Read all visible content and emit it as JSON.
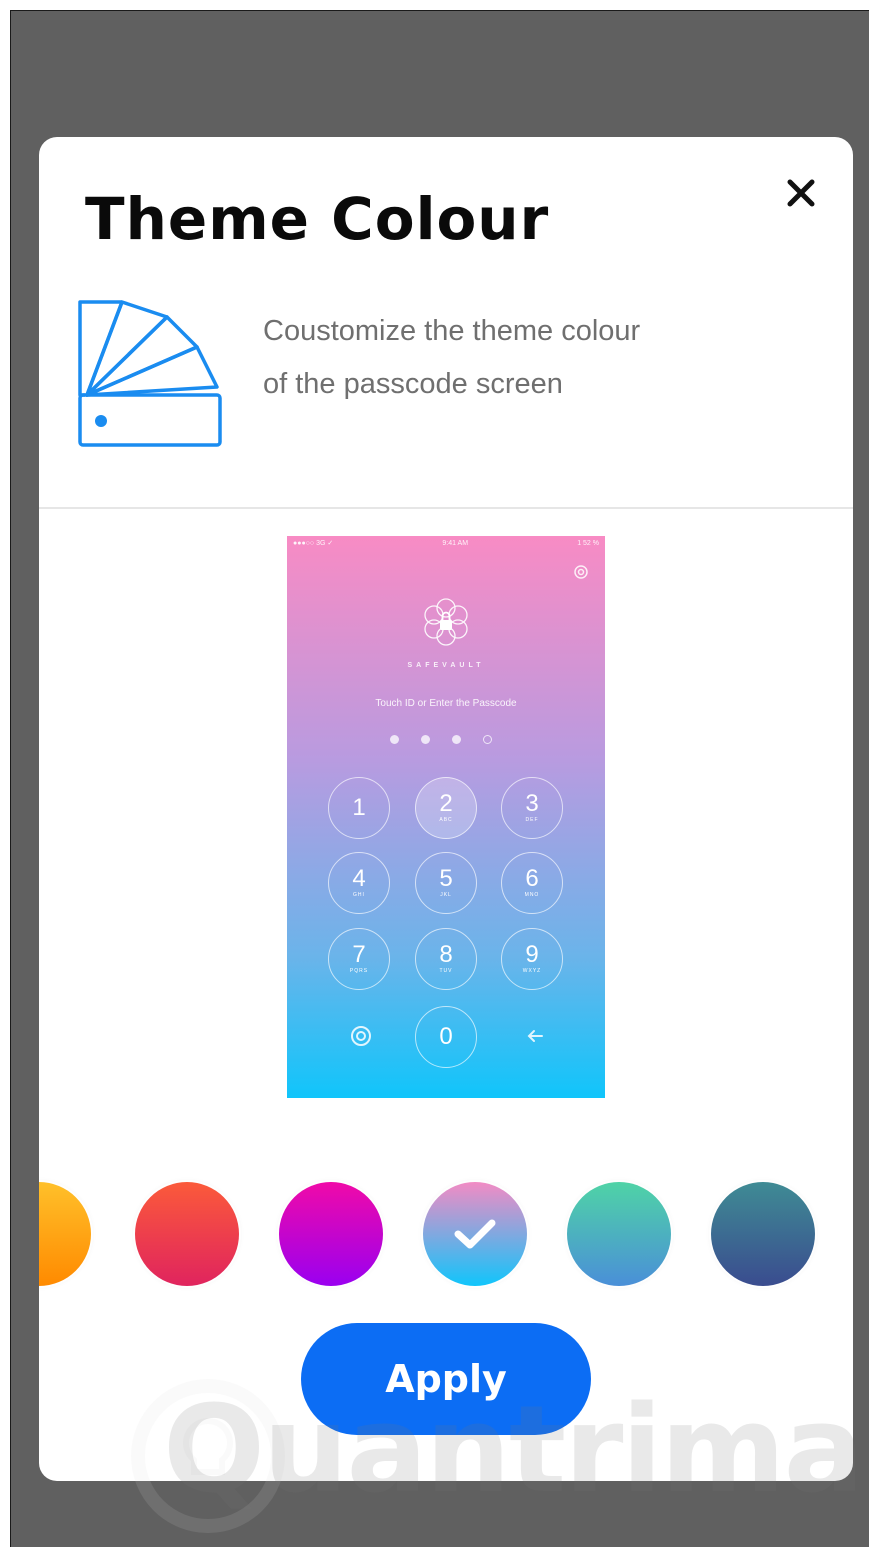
{
  "modal": {
    "title": "Theme Colour",
    "close_symbol": "✕",
    "description_line1": "Coustomize the theme colour",
    "description_line2": "of the passcode screen",
    "icon": "color-swatch-fan-icon"
  },
  "preview": {
    "status_left": "●●●○○ 3G ✓",
    "status_center": "9:41 AM",
    "status_right": "1 52 %",
    "brand": "SAFEVAULT",
    "prompt": "Touch ID or Enter the Passcode",
    "dots_filled": 3,
    "dots_total": 4,
    "keys": [
      {
        "num": "1",
        "letters": ""
      },
      {
        "num": "2",
        "letters": "ABC"
      },
      {
        "num": "3",
        "letters": "DEF"
      },
      {
        "num": "4",
        "letters": "GHI"
      },
      {
        "num": "5",
        "letters": "JKL"
      },
      {
        "num": "6",
        "letters": "MNO"
      },
      {
        "num": "7",
        "letters": "PQRS"
      },
      {
        "num": "8",
        "letters": "TUV"
      },
      {
        "num": "9",
        "letters": "WXYZ"
      },
      {
        "num": "0",
        "letters": ""
      }
    ],
    "gradient": [
      "#f88bc4",
      "#10c5fb"
    ]
  },
  "colors": [
    {
      "name": "orange",
      "from": "#ffc02a",
      "to": "#ff8a00"
    },
    {
      "name": "red",
      "from": "#fb5a3a",
      "to": "#e0245e"
    },
    {
      "name": "magenta",
      "from": "#f00aa8",
      "to": "#9a00f0"
    },
    {
      "name": "pink-blue",
      "from": "#f28bc4",
      "to": "#10c5fb",
      "selected": true
    },
    {
      "name": "teal",
      "from": "#4fd3a6",
      "to": "#4a8fd8"
    },
    {
      "name": "navy",
      "from": "#3f8b94",
      "to": "#3a4c8f"
    }
  ],
  "apply_label": "Apply",
  "watermark": "Quantrimang"
}
